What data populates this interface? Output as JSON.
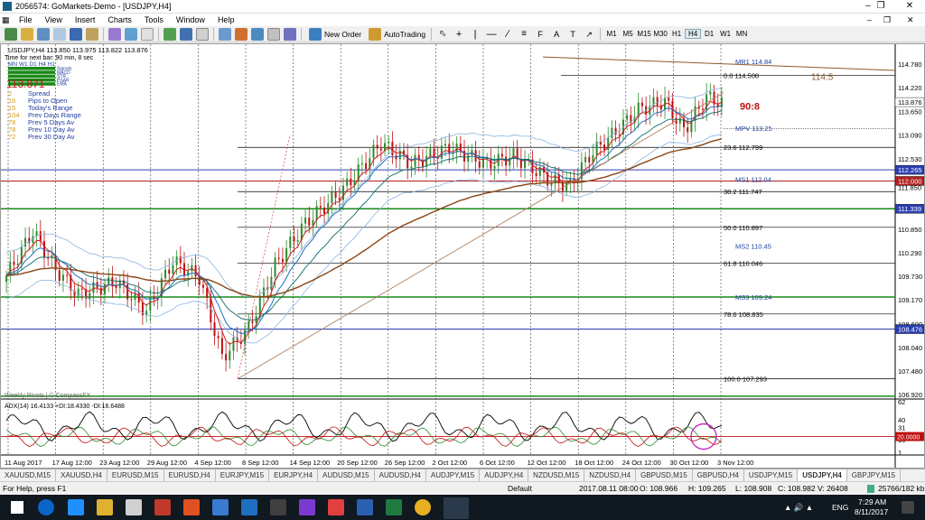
{
  "window": {
    "title": "2056574: GoMarkets-Demo - [USDJPY,H4]"
  },
  "menu": [
    "File",
    "View",
    "Insert",
    "Charts",
    "Tools",
    "Window",
    "Help"
  ],
  "toolbar": {
    "new_order": "New Order",
    "autotrading": "AutoTrading",
    "timeframes": [
      "M1",
      "M5",
      "M15",
      "M30",
      "H1",
      "H4",
      "D1",
      "W1",
      "MN"
    ]
  },
  "chart": {
    "symbol_info": "USDJPY,H4  113.850 113.975 113.822 113.876",
    "timer": "Time for next bar: 90 min, 8 sec",
    "tf_row": "MN W1 D1 H4 H1",
    "tf_sub": [
      "Signals",
      "MACD",
      "STR",
      "PSAR",
      "EMA"
    ],
    "big_price": "113.871",
    "stats": [
      {
        "value": "2",
        "label": "Spread"
      },
      {
        "value": "16",
        "label": "Pips to Open"
      },
      {
        "value": "15",
        "label": "Today's Range"
      },
      {
        "value": "104",
        "label": "Prev Days Range"
      },
      {
        "value": "78",
        "label": "Prev 5 Days Av"
      },
      {
        "value": "78",
        "label": "Prev 10 Day Av"
      },
      {
        "value": "72",
        "label": "Prev 30 Day Av"
      }
    ],
    "weekly_pivots": "Weekly Pivots | © CompassFX",
    "annotation_1145": "114.5",
    "annotation_ratio": "90:8",
    "level_labels": [
      {
        "text": "MR1  114.84"
      },
      {
        "text": "0.0  114.508"
      },
      {
        "text": "MPV  113.25"
      },
      {
        "text": "23.6  112.799"
      },
      {
        "text": "MS1  112.04"
      },
      {
        "text": "38.2  111.747"
      },
      {
        "text": "50.0  110.897"
      },
      {
        "text": "MS2  110.45"
      },
      {
        "text": "61.8  110.046"
      },
      {
        "text": "MS3  109.24"
      },
      {
        "text": "78.6  108.835"
      },
      {
        "text": "100.0  107.293"
      }
    ],
    "price_axis": [
      "114.780",
      "114.220",
      "113.650",
      "113.090",
      "112.530",
      "111.850",
      "110.850",
      "110.290",
      "109.730",
      "109.170",
      "108.600",
      "108.040",
      "107.480",
      "106.920"
    ],
    "price_tags": [
      {
        "text": "113.876",
        "bg": "#ffffff",
        "color": "#000000"
      },
      {
        "text": "112.265",
        "bg": "#2b3fb0",
        "color": "#ffffff"
      },
      {
        "text": "112.000",
        "bg": "#b02020",
        "color": "#ffffff"
      },
      {
        "text": "111.339",
        "bg": "#2b3fb0",
        "color": "#ffffff"
      },
      {
        "text": "108.476",
        "bg": "#2b3fb0",
        "color": "#ffffff"
      }
    ],
    "adx_label": "ADX(14) 16.4133 +DI:18.4330 -DI:16.6488",
    "adx_axis": [
      "62",
      "40",
      "31",
      "16",
      "1"
    ],
    "adx_tag": "20.0000",
    "time_axis": [
      "11 Aug 2017",
      "17 Aug 12:00",
      "23 Aug 12:00",
      "29 Aug 12:00",
      "4 Sep 12:00",
      "8 Sep 12:00",
      "14 Sep 12:00",
      "20 Sep 12:00",
      "26 Sep 12:00",
      "2 Oct 12:00",
      "6 Oct 12:00",
      "12 Oct 12:00",
      "18 Oct 12:00",
      "24 Oct 12:00",
      "30 Oct 12:00",
      "3 Nov 12:00"
    ],
    "colors": {
      "bull": "#2e8b2e",
      "bear": "#c01010",
      "ema_blue": "#1f6fbf",
      "ema_red": "#d02020",
      "bands": "#8cb4e0",
      "ma_brown": "#8b4513"
    }
  },
  "tabs": [
    "XAUUSD,M15",
    "XAUUSD,H4",
    "EURUSD,M15",
    "EURUSD,H4",
    "EURJPY,M15",
    "EURJPY,H4",
    "AUDUSD,M15",
    "AUDUSD,H4",
    "AUDJPY,M15",
    "AUDJPY,H4",
    "NZDUSD,M15",
    "NZDUSD,H4",
    "GBPUSD,M15",
    "GBPUSD,H4",
    "USDJPY,M15",
    "USDJPY,H4",
    "GBPJPY,M15"
  ],
  "active_tab": "USDJPY,H4",
  "status": {
    "help": "For Help, press F1",
    "profile": "Default",
    "datetime": "2017.08.11 08:00",
    "open": "O: 108.966",
    "high": "H: 109.265",
    "low": "L: 108.908",
    "close": "C: 108.982",
    "volume": "V: 26408",
    "traffic": "25766/182 kb"
  },
  "taskbar": {
    "time": "7:29 AM",
    "date": "8/11/2017",
    "lang": "ENG"
  }
}
